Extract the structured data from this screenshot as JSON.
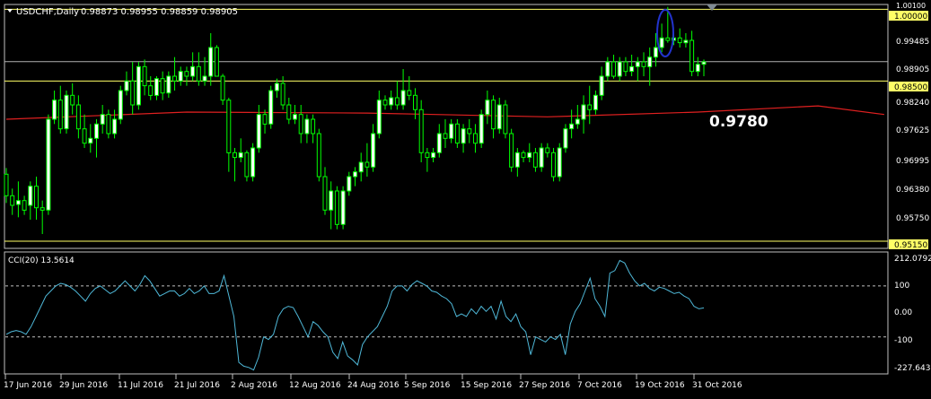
{
  "header": {
    "symbol_label": "USDCHF,Daily",
    "ohlc": "0.98873 0.98955 0.98859 0.98905"
  },
  "price_axis": {
    "labels": [
      "0.99485",
      "0.98905",
      "0.98240",
      "0.97625",
      "0.96995",
      "0.96380",
      "0.95750"
    ],
    "tag_labels": [
      "1.00000",
      "0.98500",
      "0.95150"
    ],
    "top_cut_label": "1.00100"
  },
  "annotation": {
    "text": "0.9780"
  },
  "cci_panel": {
    "title": "CCI(20) 13.5614",
    "axis_labels": [
      "212.0792",
      "100",
      "0.00",
      "-100",
      "-227.6436"
    ]
  },
  "time_axis": {
    "labels": [
      "17 Jun 2016",
      "29 Jun 2016",
      "11 Jul 2016",
      "21 Jul 2016",
      "2 Aug 2016",
      "12 Aug 2016",
      "24 Aug 2016",
      "5 Sep 2016",
      "15 Sep 2016",
      "27 Sep 2016",
      "7 Oct 2016",
      "19 Oct 2016",
      "31 Oct 2016"
    ]
  },
  "colors": {
    "background": "#000000",
    "frame": "#c0c0c0",
    "bull_candle": "#ffffff",
    "bear_candle": "#000000",
    "wick": "#00ff00",
    "moving_average": "#e02020",
    "level_line_yellow": "#ffff66",
    "level_line_gray": "#b0b0b0",
    "cci_line": "#4fb8d8",
    "highlight_ellipse": "#2233cc",
    "text": "#ffffff"
  },
  "chart_data": {
    "type": "candlestick",
    "symbol": "USDCHF",
    "timeframe": "Daily",
    "y_range": [
      0.95,
      1.001
    ],
    "horizontal_levels": [
      1.0,
      0.98905,
      0.985,
      0.9515
    ],
    "moving_average_end_value": 0.978,
    "candles": [
      [
        0.9655,
        0.9668,
        0.9595,
        0.961
      ],
      [
        0.961,
        0.9625,
        0.957,
        0.959
      ],
      [
        0.9592,
        0.964,
        0.9565,
        0.96
      ],
      [
        0.96,
        0.961,
        0.957,
        0.958
      ],
      [
        0.959,
        0.964,
        0.956,
        0.963
      ],
      [
        0.963,
        0.965,
        0.956,
        0.9585
      ],
      [
        0.9585,
        0.96,
        0.953,
        0.958
      ],
      [
        0.958,
        0.978,
        0.957,
        0.977
      ],
      [
        0.977,
        0.983,
        0.976,
        0.981
      ],
      [
        0.981,
        0.984,
        0.974,
        0.975
      ],
      [
        0.975,
        0.983,
        0.974,
        0.982
      ],
      [
        0.982,
        0.9845,
        0.978,
        0.98
      ],
      [
        0.98,
        0.982,
        0.973,
        0.975
      ],
      [
        0.975,
        0.978,
        0.971,
        0.972
      ],
      [
        0.972,
        0.976,
        0.97,
        0.973
      ],
      [
        0.973,
        0.977,
        0.969,
        0.976
      ],
      [
        0.976,
        0.98,
        0.974,
        0.978
      ],
      [
        0.978,
        0.979,
        0.973,
        0.974
      ],
      [
        0.974,
        0.979,
        0.973,
        0.977
      ],
      [
        0.977,
        0.984,
        0.976,
        0.983
      ],
      [
        0.983,
        0.987,
        0.982,
        0.985
      ],
      [
        0.985,
        0.989,
        0.978,
        0.98
      ],
      [
        0.98,
        0.989,
        0.979,
        0.988
      ],
      [
        0.988,
        0.9895,
        0.982,
        0.984
      ],
      [
        0.984,
        0.986,
        0.981,
        0.982
      ],
      [
        0.982,
        0.986,
        0.981,
        0.9855
      ],
      [
        0.9855,
        0.987,
        0.981,
        0.9825
      ],
      [
        0.9825,
        0.987,
        0.9815,
        0.986
      ],
      [
        0.986,
        0.99,
        0.983,
        0.985
      ],
      [
        0.985,
        0.988,
        0.984,
        0.987
      ],
      [
        0.987,
        0.988,
        0.984,
        0.986
      ],
      [
        0.986,
        0.991,
        0.985,
        0.988
      ],
      [
        0.988,
        0.991,
        0.984,
        0.985
      ],
      [
        0.985,
        0.99,
        0.984,
        0.986
      ],
      [
        0.986,
        0.995,
        0.984,
        0.992
      ],
      [
        0.992,
        0.9925,
        0.986,
        0.986
      ],
      [
        0.986,
        0.9865,
        0.98,
        0.981
      ],
      [
        0.981,
        0.9815,
        0.966,
        0.97
      ],
      [
        0.97,
        0.971,
        0.964,
        0.969
      ],
      [
        0.969,
        0.973,
        0.968,
        0.97
      ],
      [
        0.97,
        0.9705,
        0.964,
        0.965
      ],
      [
        0.965,
        0.972,
        0.964,
        0.971
      ],
      [
        0.971,
        0.98,
        0.97,
        0.978
      ],
      [
        0.978,
        0.979,
        0.974,
        0.976
      ],
      [
        0.976,
        0.984,
        0.975,
        0.983
      ],
      [
        0.983,
        0.9855,
        0.9815,
        0.9845
      ],
      [
        0.9845,
        0.986,
        0.979,
        0.98
      ],
      [
        0.98,
        0.9815,
        0.976,
        0.977
      ],
      [
        0.977,
        0.98,
        0.976,
        0.978
      ],
      [
        0.978,
        0.98,
        0.972,
        0.974
      ],
      [
        0.974,
        0.978,
        0.972,
        0.977
      ],
      [
        0.977,
        0.978,
        0.972,
        0.974
      ],
      [
        0.974,
        0.975,
        0.964,
        0.965
      ],
      [
        0.965,
        0.967,
        0.957,
        0.958
      ],
      [
        0.958,
        0.964,
        0.954,
        0.962
      ],
      [
        0.962,
        0.963,
        0.954,
        0.955
      ],
      [
        0.955,
        0.963,
        0.954,
        0.962
      ],
      [
        0.962,
        0.966,
        0.961,
        0.965
      ],
      [
        0.965,
        0.967,
        0.963,
        0.966
      ],
      [
        0.966,
        0.97,
        0.964,
        0.968
      ],
      [
        0.968,
        0.972,
        0.965,
        0.967
      ],
      [
        0.967,
        0.976,
        0.966,
        0.974
      ],
      [
        0.974,
        0.983,
        0.973,
        0.981
      ],
      [
        0.981,
        0.982,
        0.979,
        0.98
      ],
      [
        0.98,
        0.983,
        0.979,
        0.9815
      ],
      [
        0.9815,
        0.985,
        0.979,
        0.98
      ],
      [
        0.98,
        0.9875,
        0.979,
        0.983
      ],
      [
        0.983,
        0.986,
        0.981,
        0.982
      ],
      [
        0.982,
        0.9835,
        0.977,
        0.979
      ],
      [
        0.979,
        0.981,
        0.968,
        0.97
      ],
      [
        0.97,
        0.971,
        0.966,
        0.969
      ],
      [
        0.969,
        0.971,
        0.968,
        0.97
      ],
      [
        0.97,
        0.976,
        0.969,
        0.974
      ],
      [
        0.974,
        0.977,
        0.971,
        0.973
      ],
      [
        0.973,
        0.977,
        0.972,
        0.976
      ],
      [
        0.976,
        0.977,
        0.971,
        0.972
      ],
      [
        0.972,
        0.976,
        0.97,
        0.975
      ],
      [
        0.975,
        0.977,
        0.972,
        0.974
      ],
      [
        0.974,
        0.976,
        0.97,
        0.972
      ],
      [
        0.972,
        0.979,
        0.971,
        0.978
      ],
      [
        0.978,
        0.983,
        0.976,
        0.981
      ],
      [
        0.981,
        0.982,
        0.973,
        0.975
      ],
      [
        0.975,
        0.9815,
        0.974,
        0.98
      ],
      [
        0.98,
        0.981,
        0.973,
        0.974
      ],
      [
        0.974,
        0.975,
        0.966,
        0.967
      ],
      [
        0.967,
        0.971,
        0.965,
        0.97
      ],
      [
        0.97,
        0.9705,
        0.968,
        0.969
      ],
      [
        0.969,
        0.972,
        0.968,
        0.97
      ],
      [
        0.97,
        0.971,
        0.966,
        0.967
      ],
      [
        0.967,
        0.972,
        0.966,
        0.971
      ],
      [
        0.971,
        0.972,
        0.969,
        0.97
      ],
      [
        0.97,
        0.971,
        0.964,
        0.965
      ],
      [
        0.965,
        0.972,
        0.964,
        0.971
      ],
      [
        0.971,
        0.976,
        0.97,
        0.975
      ],
      [
        0.975,
        0.979,
        0.973,
        0.976
      ],
      [
        0.976,
        0.98,
        0.975,
        0.977
      ],
      [
        0.977,
        0.982,
        0.974,
        0.98
      ],
      [
        0.98,
        0.984,
        0.976,
        0.979
      ],
      [
        0.979,
        0.983,
        0.978,
        0.982
      ],
      [
        0.982,
        0.988,
        0.981,
        0.986
      ],
      [
        0.986,
        0.99,
        0.985,
        0.989
      ],
      [
        0.989,
        0.9905,
        0.9855,
        0.986
      ],
      [
        0.986,
        0.99,
        0.985,
        0.989
      ],
      [
        0.989,
        0.99,
        0.986,
        0.987
      ],
      [
        0.987,
        0.9905,
        0.986,
        0.988
      ],
      [
        0.988,
        0.99,
        0.985,
        0.989
      ],
      [
        0.989,
        0.991,
        0.986,
        0.988
      ],
      [
        0.988,
        0.992,
        0.984,
        0.99
      ],
      [
        0.99,
        0.995,
        0.988,
        0.992
      ],
      [
        0.992,
        0.997,
        0.991,
        0.994
      ],
      [
        0.994,
        1.0005,
        0.993,
        0.9935
      ],
      [
        0.9935,
        0.995,
        0.9925,
        0.994
      ],
      [
        0.994,
        0.996,
        0.992,
        0.993
      ],
      [
        0.993,
        0.995,
        0.992,
        0.9935
      ],
      [
        0.9935,
        0.9955,
        0.986,
        0.987
      ],
      [
        0.987,
        0.99,
        0.986,
        0.9885
      ],
      [
        0.9885,
        0.9895,
        0.986,
        0.989
      ]
    ],
    "moving_average": [
      [
        0,
        0.977
      ],
      [
        30,
        0.9785
      ],
      [
        60,
        0.9783
      ],
      [
        90,
        0.9775
      ],
      [
        115,
        0.9785
      ],
      [
        135,
        0.9798
      ],
      [
        146,
        0.978
      ]
    ],
    "cci": {
      "y_range": [
        -227.6436,
        212.0792
      ],
      "levels": [
        100,
        0,
        -100
      ],
      "last_value": 13.5614,
      "values": [
        -90,
        -80,
        -75,
        -80,
        -90,
        -60,
        -20,
        20,
        60,
        80,
        100,
        110,
        105,
        95,
        80,
        60,
        40,
        70,
        90,
        100,
        85,
        70,
        80,
        100,
        120,
        100,
        80,
        105,
        140,
        120,
        90,
        60,
        70,
        80,
        80,
        60,
        70,
        90,
        70,
        80,
        100,
        70,
        70,
        80,
        140,
        60,
        -20,
        -200,
        -215,
        -220,
        -230,
        -180,
        -100,
        -110,
        -90,
        -20,
        10,
        20,
        15,
        -20,
        -60,
        -100,
        -40,
        -55,
        -80,
        -100,
        -160,
        -185,
        -120,
        -175,
        -190,
        -210,
        -130,
        -100,
        -80,
        -60,
        -20,
        20,
        80,
        100,
        100,
        80,
        105,
        120,
        110,
        100,
        80,
        75,
        60,
        50,
        30,
        -20,
        -10,
        -20,
        10,
        -10,
        20,
        0,
        20,
        -30,
        40,
        -20,
        -40,
        -10,
        -60,
        -80,
        -170,
        -100,
        -110,
        -120,
        -100,
        -110,
        -90,
        -170,
        -50,
        0,
        30,
        80,
        130,
        50,
        20,
        -20,
        150,
        160,
        200,
        190,
        150,
        120,
        100,
        110,
        90,
        80,
        95,
        90,
        80,
        70,
        75,
        60,
        50,
        20,
        10,
        13.5614
      ]
    }
  }
}
